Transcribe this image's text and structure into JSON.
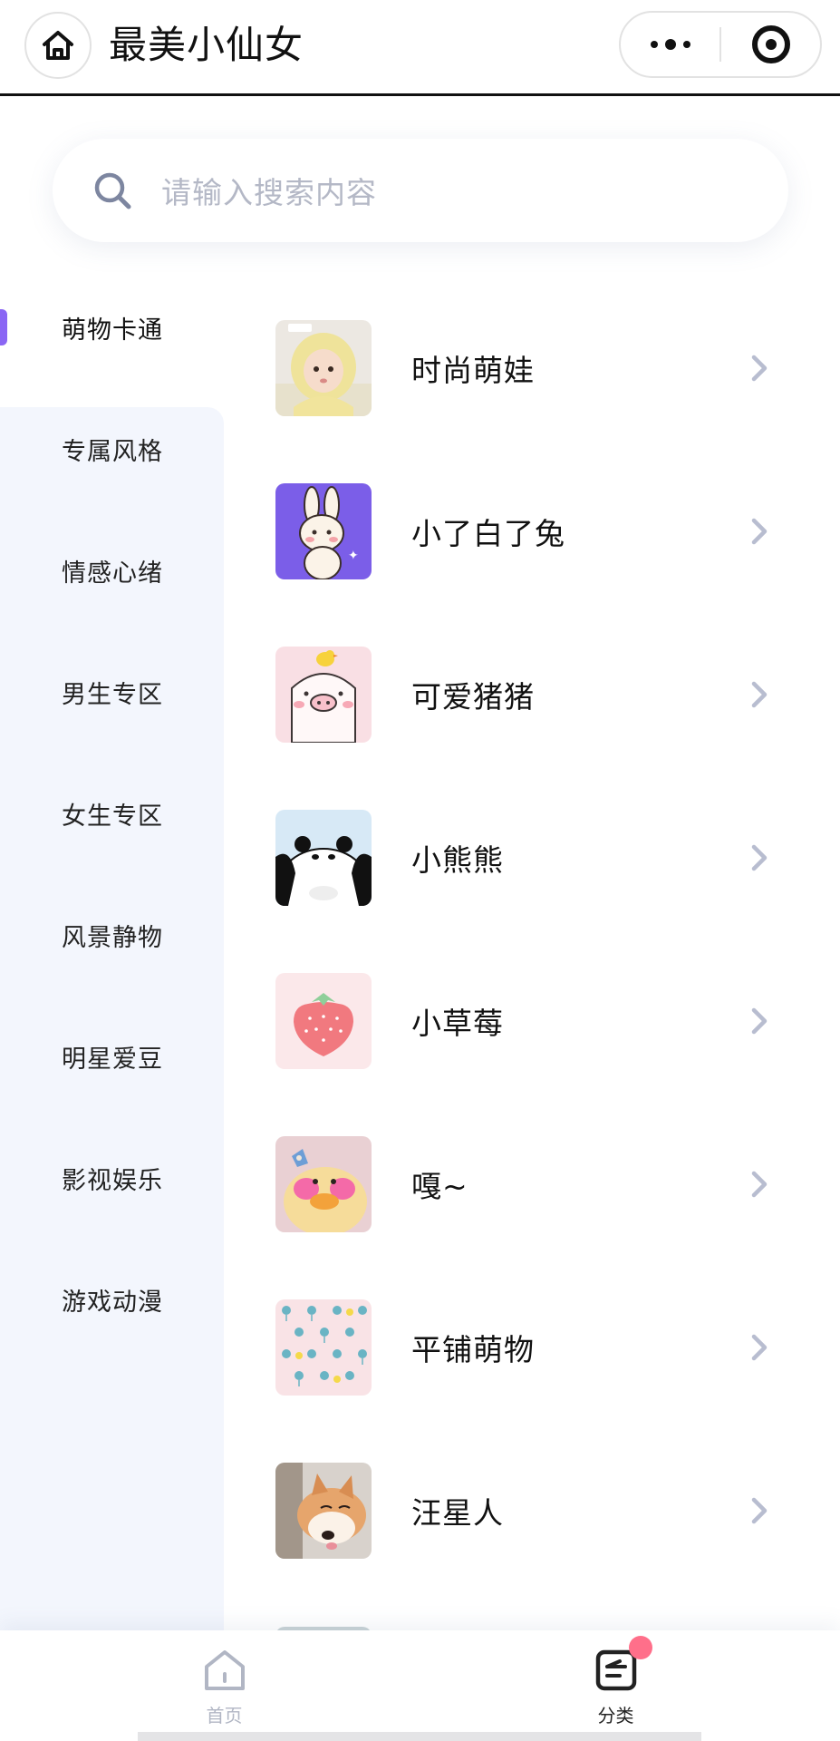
{
  "navbar": {
    "title": "最美小仙女",
    "home_icon": "home-icon",
    "more_icon": "more-dots-icon",
    "close_icon": "target-icon"
  },
  "search": {
    "placeholder": "请输入搜索内容",
    "icon": "search-icon"
  },
  "sidebar": {
    "accent_color": "#8a66f4",
    "background": "#f3f6fd",
    "items": [
      {
        "label": "萌物卡通",
        "active": true
      },
      {
        "label": "专属风格"
      },
      {
        "label": "情感心绪"
      },
      {
        "label": "男生专区"
      },
      {
        "label": "女生专区"
      },
      {
        "label": "风景静物"
      },
      {
        "label": "明星爱豆"
      },
      {
        "label": "影视娱乐"
      },
      {
        "label": "游戏动漫"
      }
    ]
  },
  "list": {
    "items": [
      {
        "label": "时尚萌娃",
        "thumb": "baby-photo"
      },
      {
        "label": "小了白了兔",
        "thumb": "bunny-cartoon"
      },
      {
        "label": "可爱猪猪",
        "thumb": "pig-cartoon"
      },
      {
        "label": "小熊熊",
        "thumb": "panda-cartoon"
      },
      {
        "label": "小草莓",
        "thumb": "strawberry"
      },
      {
        "label": "嘎~",
        "thumb": "duck-plush"
      },
      {
        "label": "平铺萌物",
        "thumb": "tiled-pattern"
      },
      {
        "label": "汪星人",
        "thumb": "shiba-dog"
      }
    ]
  },
  "tabbar": {
    "tabs": [
      {
        "label": "首页",
        "icon": "home-icon",
        "active": false
      },
      {
        "label": "分类",
        "icon": "category-icon",
        "active": true
      }
    ]
  }
}
